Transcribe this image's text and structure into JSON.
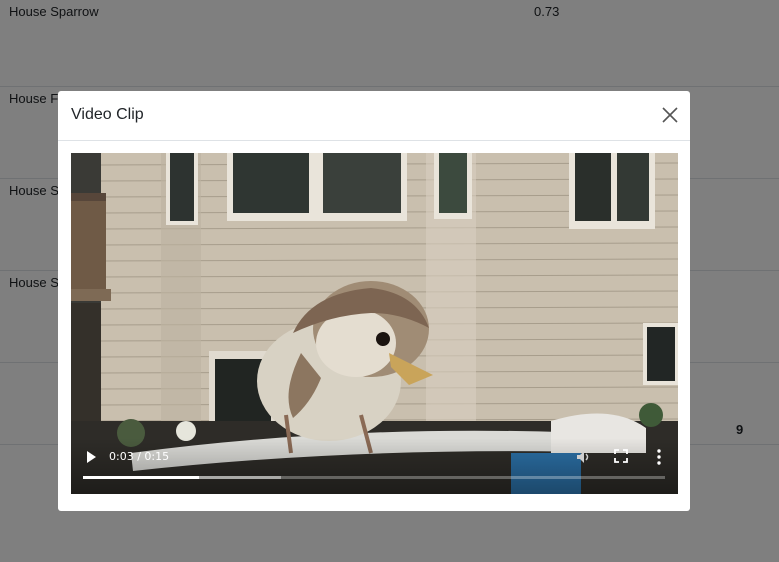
{
  "table": {
    "rows": [
      {
        "name": "House Sparrow",
        "score": "0.73"
      },
      {
        "name": "House Fi",
        "score": ""
      },
      {
        "name": "House Sp",
        "score": ""
      },
      {
        "name": "House Sp",
        "score": ""
      }
    ],
    "total": "9"
  },
  "modal": {
    "title": "Video Clip"
  },
  "video": {
    "time_display": "0:03 / 0:15",
    "progress_played": 0.2,
    "progress_buffered": 0.34
  },
  "icons": {
    "close": "close-icon",
    "play": "play-icon",
    "mute": "volume-icon",
    "fullscreen": "fullscreen-icon",
    "more": "more-vert-icon"
  }
}
